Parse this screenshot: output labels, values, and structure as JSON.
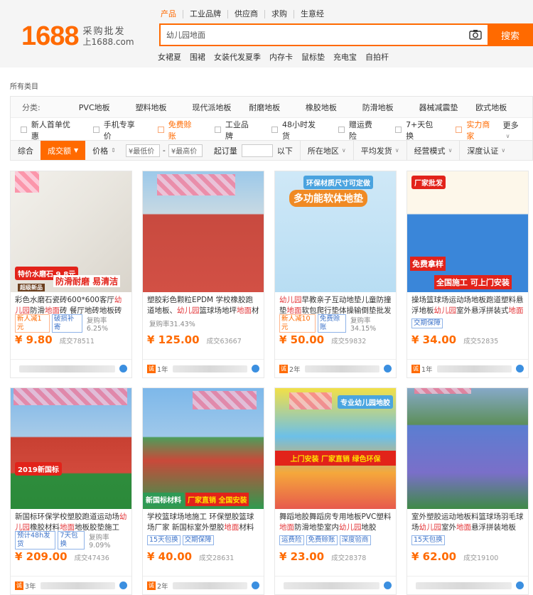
{
  "logo": {
    "number": "1688",
    "slogan_line1": "采购批发",
    "slogan_line2": "上1688.com"
  },
  "tabs": [
    "产品",
    "工业品牌",
    "供应商",
    "求购",
    "生意经"
  ],
  "search": {
    "value": "幼儿园地面",
    "button": "搜索"
  },
  "hot_words": [
    "女裙夏",
    "围裙",
    "女装代发夏季",
    "内存卡",
    "鼠标垫",
    "充电宝",
    "自拍杆"
  ],
  "breadcrumb": "所有类目",
  "categories": {
    "label": "分类:",
    "items": [
      "PVC地板",
      "塑料地板",
      "现代派地板",
      "耐磨地板",
      "橡胶地板",
      "防滑地板",
      "器械减震垫",
      "欧式地板"
    ]
  },
  "options": [
    {
      "label": "新人首单优惠",
      "orange": false
    },
    {
      "label": "手机专享价",
      "orange": false
    },
    {
      "label": "免费赊账",
      "orange": true
    },
    {
      "label": "工业品牌",
      "orange": false
    },
    {
      "label": "48小时发货",
      "orange": false
    },
    {
      "label": "赠运费险",
      "orange": false
    },
    {
      "label": "7+天包换",
      "orange": false
    },
    {
      "label": "实力商家",
      "orange": true
    }
  ],
  "more_label": "更多",
  "sort": {
    "overall": "综合",
    "volume": "成交额",
    "price": "价格",
    "min_price": "¥最低价",
    "dash": "-",
    "max_price": "¥最高价",
    "moq": "起订量",
    "moq_unit": "以下",
    "selects": [
      "所在地区",
      "平均发货",
      "经营模式",
      "深度认证"
    ]
  },
  "products": [
    {
      "title_parts": [
        [
          "彩色水磨石瓷砖600*600客厅",
          false
        ],
        [
          "幼儿园",
          true
        ],
        [
          "防滑",
          false
        ],
        [
          "地面",
          true
        ],
        [
          "砖 餐厅地砖地板砖",
          false
        ]
      ],
      "tags": [
        {
          "text": "新人减1元",
          "style": "orange"
        },
        {
          "text": "破损补寄",
          "style": "blue"
        }
      ],
      "repurchase": "复购率6.25%",
      "price": "¥ 9.80",
      "deals": "成交78511",
      "shop_years": "",
      "banner": "防滑耐磨 易清洁",
      "badge": "特价水磨石 9.8元",
      "sub_badge": "超级新品"
    },
    {
      "title_parts": [
        [
          "塑胶彩色颗粒EPDM 学校橡胶跑道地板、",
          false
        ],
        [
          "幼儿园",
          true
        ],
        [
          "篮球场地坪",
          false
        ],
        [
          "地面",
          true
        ],
        [
          "材料",
          false
        ]
      ],
      "tags": [],
      "repurchase": "复购率31.43%",
      "price": "¥ 125.00",
      "deals": "成交63667",
      "shop_years": "1年",
      "banner": "",
      "badge": "",
      "sub_badge": ""
    },
    {
      "title_parts": [
        [
          "幼儿园",
          true
        ],
        [
          "早教亲子互动地垫儿童防撞垫",
          false
        ],
        [
          "地面",
          true
        ],
        [
          "软包爬行垫体操输倒垫批发",
          false
        ]
      ],
      "tags": [
        {
          "text": "新人减10元",
          "style": "orange"
        },
        {
          "text": "免费赊账",
          "style": "blue"
        }
      ],
      "repurchase": "复购率34.15%",
      "price": "¥ 50.00",
      "deals": "成交59832",
      "shop_years": "2年",
      "banner": "多功能软体地垫",
      "badge": "环保材质尺寸可定做",
      "sub_badge": ""
    },
    {
      "title_parts": [
        [
          "操场篮球场运动场地板跑道塑料悬浮地板",
          false
        ],
        [
          "幼儿园",
          true
        ],
        [
          "室外悬浮拼装式",
          false
        ],
        [
          "地面",
          true
        ]
      ],
      "tags": [
        {
          "text": "交期保障",
          "style": "blue"
        }
      ],
      "repurchase": "",
      "price": "¥ 34.00",
      "deals": "成交52835",
      "shop_years": "1年",
      "banner": "全国施工 可上门安装",
      "badge": "厂家批发",
      "sub_badge": "免费拿样"
    },
    {
      "title_parts": [
        [
          "新国标环保学校塑胶跑道运动场",
          false
        ],
        [
          "幼儿园",
          true
        ],
        [
          "橡胶材料",
          false
        ],
        [
          "地面",
          true
        ],
        [
          "地板胶垫施工",
          false
        ]
      ],
      "tags": [
        {
          "text": "预计48h发货",
          "style": "blue"
        },
        {
          "text": "7天包换",
          "style": "blue"
        }
      ],
      "repurchase": "复购率9.09%",
      "price": "¥ 209.00",
      "deals": "成交47436",
      "shop_years": "3年",
      "banner": "",
      "badge": "2019新国标",
      "sub_badge": ""
    },
    {
      "title_parts": [
        [
          "学校篮球场地施工 环保塑胶篮球场厂家 新国标室外塑胶",
          false
        ],
        [
          "地面",
          true
        ],
        [
          "材料",
          false
        ]
      ],
      "tags": [
        {
          "text": "15天包换",
          "style": "blue"
        },
        {
          "text": "交期保障",
          "style": "blue"
        }
      ],
      "repurchase": "",
      "price": "¥ 40.00",
      "deals": "成交28631",
      "shop_years": "2年",
      "banner": "厂家直销 全国安装",
      "badge": "新国标材料",
      "sub_badge": ""
    },
    {
      "title_parts": [
        [
          "舞蹈地胶舞蹈房专用地板PVC塑料",
          false
        ],
        [
          "地面",
          true
        ],
        [
          "防滑地垫室内",
          false
        ],
        [
          "幼儿园",
          true
        ],
        [
          "地胶",
          false
        ]
      ],
      "tags": [
        {
          "text": "运费险",
          "style": "blue"
        },
        {
          "text": "免费赊账",
          "style": "blue"
        },
        {
          "text": "深度验商",
          "style": "blue"
        }
      ],
      "repurchase": "",
      "price": "¥ 23.00",
      "deals": "成交28378",
      "shop_years": "",
      "banner": "上门安装 厂家直销 绿色环保",
      "badge": "专业幼儿园地胶",
      "sub_badge": ""
    },
    {
      "title_parts": [
        [
          "室外塑胶运动地板料篮球场羽毛球场",
          false
        ],
        [
          "幼儿园",
          true
        ],
        [
          "室外",
          false
        ],
        [
          "地面",
          true
        ],
        [
          "悬浮拼装地板",
          false
        ]
      ],
      "tags": [
        {
          "text": "15天包换",
          "style": "blue"
        }
      ],
      "repurchase": "",
      "price": "¥ 62.00",
      "deals": "成交19100",
      "shop_years": "",
      "banner": "",
      "badge": "",
      "sub_badge": ""
    }
  ],
  "colors": {
    "accent": "#ff6a00",
    "highlight": "#e4393c",
    "tag_blue": "#3d73c9"
  }
}
